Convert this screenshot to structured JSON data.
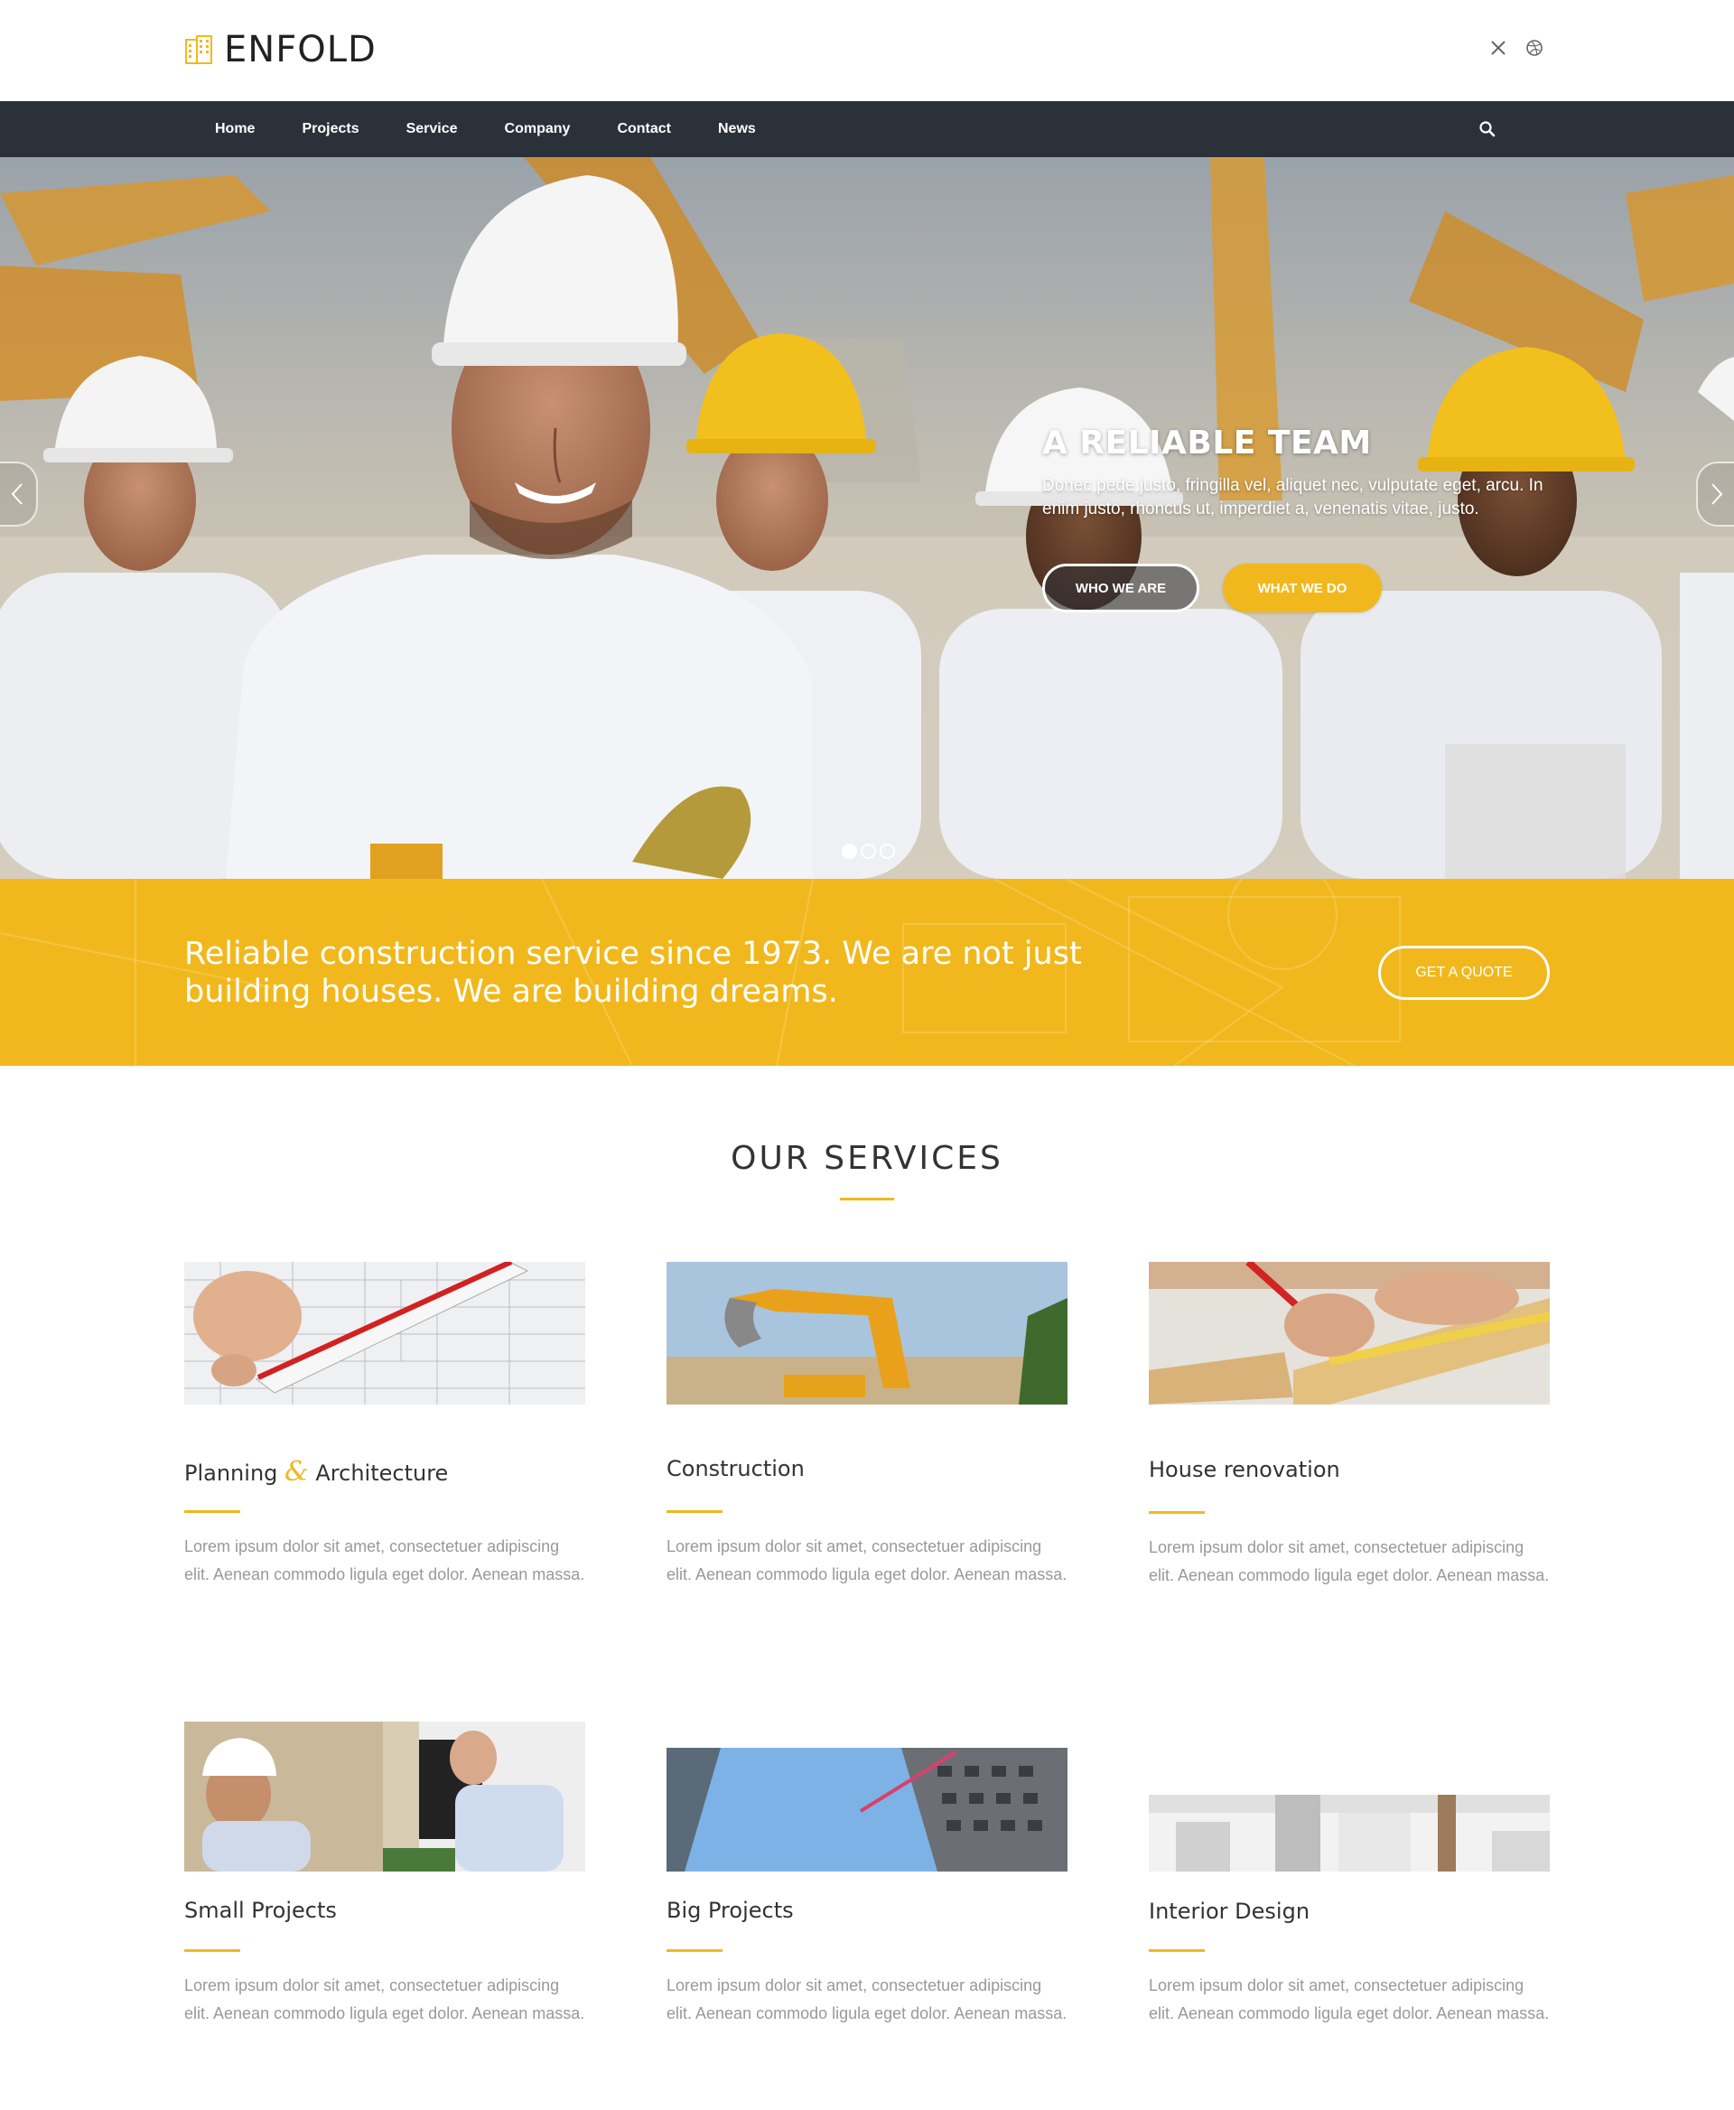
{
  "header": {
    "logo_text": "ENFOLD",
    "social_icons": [
      "x-twitter-icon",
      "dribbble-icon"
    ]
  },
  "nav": {
    "items": [
      "Home",
      "Projects",
      "Service",
      "Company",
      "Contact",
      "News"
    ],
    "search_icon": "search-icon"
  },
  "hero": {
    "title": "A RELIABLE TEAM",
    "description": "Donec pede justo, fringilla vel, aliquet nec, vulputate eget, arcu. In enim justo, rhoncus ut, imperdiet a, venenatis vitae, justo.",
    "button_primary": "WHO WE ARE",
    "button_secondary": "WHAT WE DO",
    "slide_count": 3,
    "active_slide": 1
  },
  "band": {
    "text": "Reliable construction service since 1973. We are not just building houses. We are building dreams.",
    "button": "GET A QUOTE"
  },
  "services": {
    "title": "OUR SERVICES",
    "items": [
      {
        "name_before": "Planning ",
        "amp": "&",
        "name_after": " Architecture",
        "desc": "Lorem ipsum dolor sit amet, consectetuer adipiscing elit. Aenean commodo ligula eget dolor. Aenean massa."
      },
      {
        "name": "Construction",
        "desc": "Lorem ipsum dolor sit amet, consectetuer adipiscing elit. Aenean commodo ligula eget dolor. Aenean massa."
      },
      {
        "name": "House renovation",
        "desc": "Lorem ipsum dolor sit amet, consectetuer adipiscing elit. Aenean commodo ligula eget dolor. Aenean massa."
      },
      {
        "name": "Small Projects",
        "desc": "Lorem ipsum dolor sit amet, consectetuer adipiscing elit. Aenean commodo ligula eget dolor. Aenean massa."
      },
      {
        "name": "Big Projects",
        "desc": "Lorem ipsum dolor sit amet, consectetuer adipiscing elit. Aenean commodo ligula eget dolor. Aenean massa."
      },
      {
        "name": "Interior Design",
        "desc": "Lorem ipsum dolor sit amet, consectetuer adipiscing elit. Aenean commodo ligula eget dolor. Aenean massa."
      }
    ]
  },
  "colors": {
    "accent": "#f1b81d",
    "nav_bg": "#2b3139",
    "text_dark": "#333333",
    "text_muted": "#999999"
  }
}
